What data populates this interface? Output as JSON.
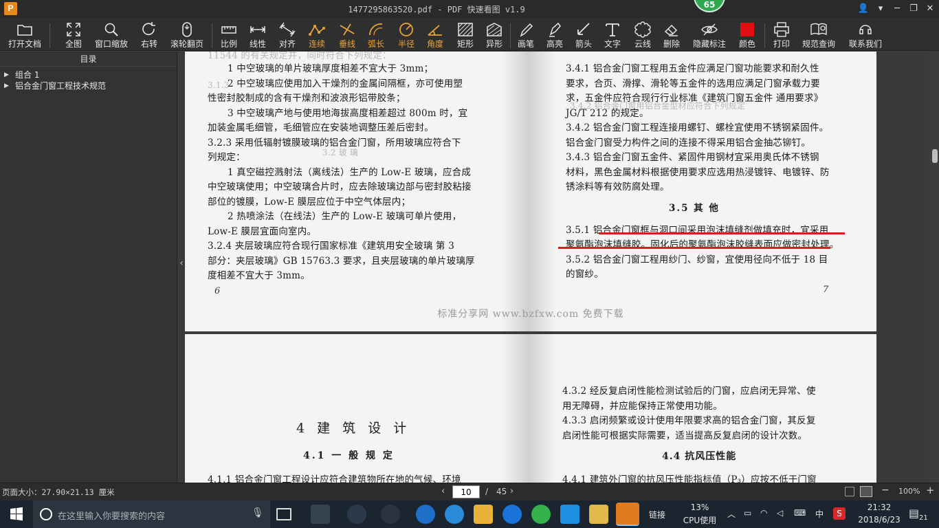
{
  "window": {
    "app_logo": "P",
    "title": "1477295863520.pdf - PDF 快速看图 v1.9",
    "badge": "65",
    "controls": [
      "👤",
      "▾",
      "─",
      "❐",
      "✕"
    ]
  },
  "toolbar": {
    "open": "打开文档",
    "fit_all": "全图",
    "window_zoom": "窗口缩放",
    "rotate_right": "右转",
    "scroll_page": "滚轮翻页",
    "scale": "比例",
    "linear": "线性",
    "align": "对齐",
    "polyline": "连续",
    "perpendicular": "垂线",
    "arc_length": "弧长",
    "radius": "半径",
    "angle": "角度",
    "rectangle": "矩形",
    "irregular": "异形",
    "pen": "画笔",
    "highlight": "高亮",
    "arrow": "箭头",
    "text": "文字",
    "cloud": "云线",
    "delete": "删除",
    "hide_marks": "隐藏标注",
    "color": "颜色",
    "color_value": "#e01010",
    "print": "打印",
    "standard_query": "规范查询",
    "contact": "联系我们"
  },
  "sidebar": {
    "title": "目录",
    "items": [
      {
        "label": "组合 1"
      },
      {
        "label": "铝合金门窗工程技术规范"
      }
    ]
  },
  "document": {
    "page1_left": {
      "lines": [
        "1 中空玻璃的单片玻璃厚度相差不宜大于 3mm；",
        "2 中空玻璃应使用加入干燥剂的金属间隔框，亦可使用塑",
        "性密封胶制成的含有干燥剂和波浪形铝带胶条；",
        "3 中空玻璃产地与使用地海拔高度相差超过 800m 时，宜",
        "加装金属毛细管，毛细管应在安装地调整压差后密封。",
        "3.2.3 采用低辐射镀膜玻璃的铝合金门窗，所用玻璃应符合下",
        "列规定：",
        "1 真空磁控溅射法（离线法）生产的 Low-E 玻璃，应合成",
        "中空玻璃使用；中空玻璃合片时，应去除玻璃边部与密封胶粘接",
        "部位的镀膜，Low-E 膜层应位于中空气体层内；",
        "2 热喷涂法（在线法）生产的 Low-E 玻璃可单片使用，",
        "Low-E 膜层宜面向室内。",
        "3.2.4 夹层玻璃应符合现行国家标准《建筑用安全玻璃 第 3",
        "部分：夹层玻璃》GB 15763.3 要求，且夹层玻璃的单片玻璃厚",
        "度相差不宜大于 3mm。"
      ],
      "page_number": "6"
    },
    "page1_right": {
      "lines": [
        "3.4.1 铝合金门窗工程用五金件应满足门窗功能要求和耐久性",
        "要求，合页、滑撑、滑轮等五金件的选用应满足门窗承载力要",
        "求，五金件应符合现行行业标准《建筑门窗五金件 通用要求》",
        "JG/T 212 的规定。",
        "3.4.2 铝合金门窗工程连接用螺钉、螺栓宜使用不锈钢紧固件。",
        "铝合金门窗受力构件之间的连接不得采用铝合金抽芯铆钉。",
        "3.4.3 铝合金门窗五金件、紧固件用钢材宜采用奥氏体不锈钢",
        "材料，黑色金属材料根据使用要求应选用热浸镀锌、电镀锌、防",
        "锈涂料等有效防腐处理。",
        "3.5 其 他",
        "3.5.1 铝合金门窗框与洞口间采用泡沫填缝剂做填充时，宜采用",
        "聚氨酯泡沫填缝胶。固化后的聚氨酯泡沫胶缝表面应做密封处理。",
        "3.5.2 铝合金门窗工程用纱门、纱窗，宜使用径向不低于 18 目",
        "的窗纱。"
      ],
      "page_number": "7"
    },
    "watermark": "标准分享网 www.bzfxw.com 免费下载",
    "page2_left": {
      "chapter": "4 建 筑 设 计",
      "section": "4.1 一 般 规 定",
      "line": "4.1.1 铝合金门窗工程设计应符合建筑物所在地的气候、环境"
    },
    "page2_right": {
      "lines": [
        "4.3.2 经反复启闭性能检测试验后的门窗，应启闭无异常、使",
        "用无障碍，并应能保持正常使用功能。",
        "4.3.3 启闭频繁或设计使用年限要求高的铝合金门窗，其反复",
        "启闭性能可根据实际需要，适当提高反复启闭的设计次数。"
      ],
      "section": "4.4 抗风压性能",
      "line": "4.4.1 建筑外门窗的抗风压性能指标值（P₃）应按不低于门窗"
    },
    "faint_lines": [
      "11544 的有关规定并，同时符合下列规定：",
      "3.1.3",
      "3.2 玻 璃",
      "3.4.2 铝合金门窗用铝合金型材应符合下列规定"
    ]
  },
  "statusbar": {
    "page_size": "页面大小：27.90×21.13 厘米",
    "current_page": "10",
    "separator": "/",
    "total_pages": "45",
    "zoom": "100%"
  },
  "taskbar": {
    "search_placeholder": "在这里输入你要搜索的内容",
    "tray_link": "链接",
    "cpu_percent": "13%",
    "cpu_label": "CPU使用",
    "ime": "中",
    "time": "21:32",
    "date": "2018/6/23",
    "notifications": "21"
  }
}
